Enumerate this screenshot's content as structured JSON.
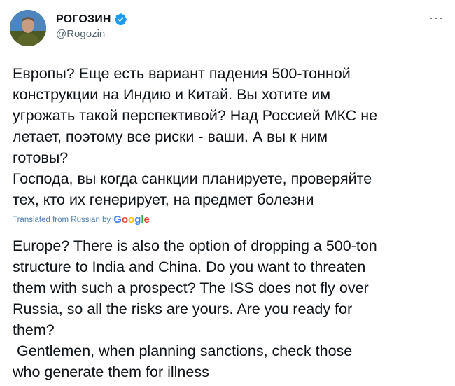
{
  "author": {
    "display_name": "РОГОЗИН",
    "handle": "@Rogozin",
    "verified_icon": "verified-badge-icon",
    "more_icon": "more-horizontal-icon"
  },
  "tweet": {
    "original_text": "Европы? Еще есть вариант падения 500-тонной\nконструкции на Индию и Китай. Вы хотите им\nугрожать такой перспективой? Над Россией МКС не\nлетает, поэтому все риски - ваши. А вы к ним\nготовы?\nГоспода, вы когда санкции планируете, проверяйте\nтех, кто их генерирует, на предмет болезни",
    "translation_label": "Translated from Russian by",
    "translation_provider": [
      "G",
      "o",
      "o",
      "g",
      "l",
      "e"
    ],
    "translated_text": "Europe? There is also the option of dropping a 500-ton\nstructure to India and China. Do you want to threaten\nthem with such a prospect? The ISS does not fly over\nRussia, so all the risks are yours. Are you ready for\nthem?\n Gentlemen, when planning sanctions, check those\nwho generate them for illness"
  },
  "colors": {
    "text": "#0f1419",
    "secondary": "#536471",
    "verified": "#1d9bf0"
  }
}
